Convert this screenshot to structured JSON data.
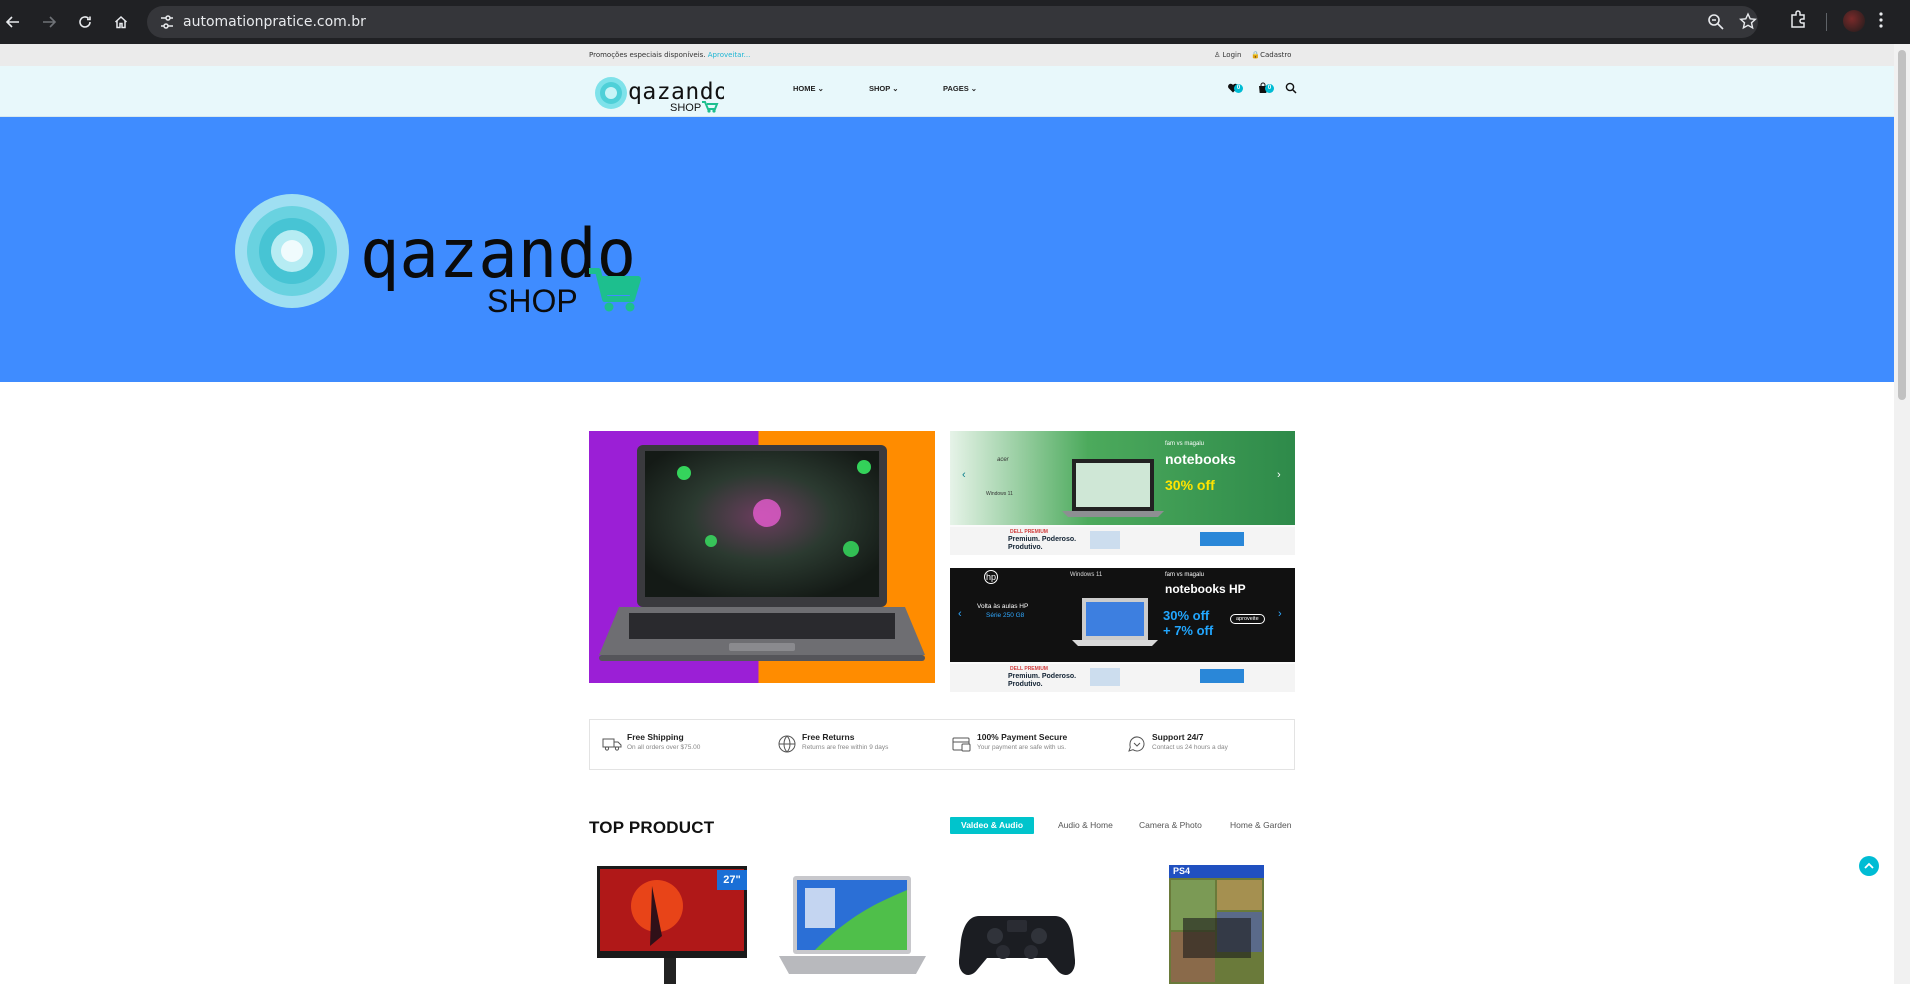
{
  "browser": {
    "url": "automationpratice.com.br",
    "icons": [
      "back-icon",
      "forward-icon",
      "reload-icon",
      "home-icon",
      "site-settings-icon",
      "zoom-icon",
      "bookmark-star-icon",
      "extensions-icon",
      "profile-avatar",
      "menu-kebab-icon"
    ]
  },
  "topbar": {
    "promo_text": "Promoções especiais disponíveis.",
    "promo_link": "Aproveitar...",
    "login": "Login",
    "signup": "Cadastro"
  },
  "logo": {
    "word": "qazando",
    "sub": "SHOP"
  },
  "nav": {
    "items": [
      {
        "label": "HOME"
      },
      {
        "label": "SHOP"
      },
      {
        "label": "PAGES"
      }
    ],
    "wishlist_count": "0",
    "cart_count": "0"
  },
  "hero": {
    "word": "qazando",
    "sub": "SHOP"
  },
  "banners": {
    "acer": {
      "store": "fam vs magalu",
      "brand": "acer",
      "title": "notebooks",
      "offer": "30% off",
      "os": "Windows 11"
    },
    "hp": {
      "store": "fam vs magalu",
      "brand": "hp",
      "title": "notebooks HP",
      "headline": "Volta às aulas HP",
      "series": "Série 250 G8",
      "offer1": "30% off",
      "offer2": "+ 7% off",
      "cta": "aproveite",
      "os": "Windows 11"
    },
    "dell": {
      "tag": "DELL PREMIUM",
      "text": "Premium. Poderoso. Produtivo."
    }
  },
  "features": [
    {
      "title": "Free Shipping",
      "subtitle": "On all orders over $75.00"
    },
    {
      "title": "Free Returns",
      "subtitle": "Returns are free within 9 days"
    },
    {
      "title": "100% Payment Secure",
      "subtitle": "Your payment are safe with us."
    },
    {
      "title": "Support 24/7",
      "subtitle": "Contact us 24 hours a day"
    }
  ],
  "top_product": {
    "title": "TOP PRODUCT",
    "tabs": [
      "Valdeo & Audio",
      "Audio & Home",
      "Camera & Photo",
      "Home & Garden"
    ],
    "active_tab": 0,
    "products": [
      {
        "kind": "monitor",
        "badge": "27\""
      },
      {
        "kind": "laptop"
      },
      {
        "kind": "gamepad"
      },
      {
        "kind": "ps4-game",
        "platform": "PS4"
      }
    ]
  },
  "colors": {
    "accent": "#00c4cc",
    "hero_bg": "#3f8cff",
    "header_bg": "#e8f8fb"
  }
}
